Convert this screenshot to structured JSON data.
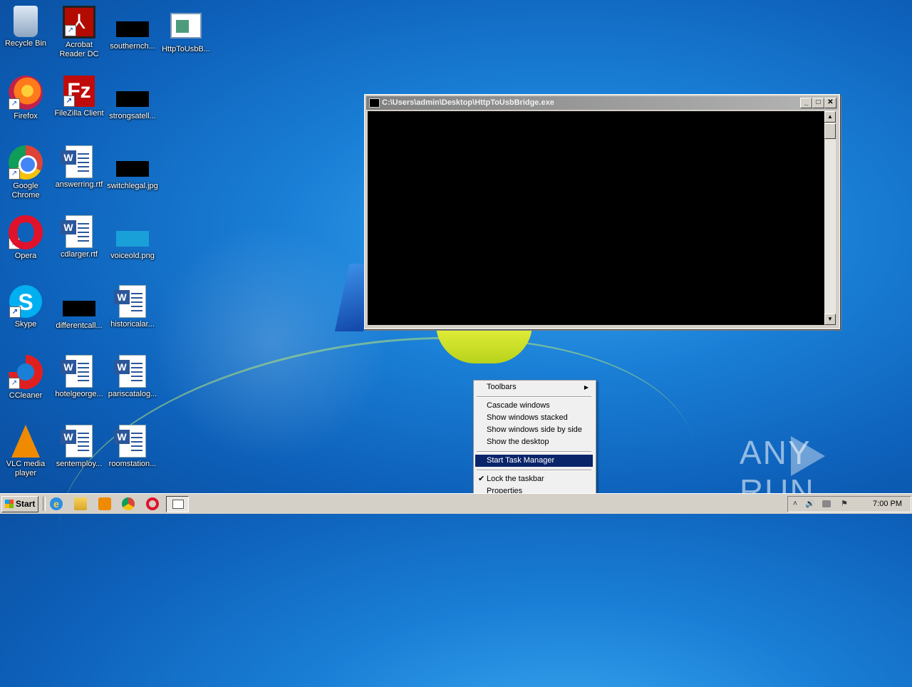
{
  "desktop_icons": [
    {
      "label": "Recycle Bin",
      "icon": "recycle-bin-icon"
    },
    {
      "label": "Acrobat Reader DC",
      "icon": "acrobat-icon"
    },
    {
      "label": "southernch...",
      "icon": "black-image-icon"
    },
    {
      "label": "HttpToUsbB...",
      "icon": "application-window-icon"
    },
    {
      "label": "Firefox",
      "icon": "firefox-icon"
    },
    {
      "label": "FileZilla Client",
      "icon": "filezilla-icon"
    },
    {
      "label": "strongsatell...",
      "icon": "black-image-icon"
    },
    {
      "label": "Google Chrome",
      "icon": "chrome-icon"
    },
    {
      "label": "answerring.rtf",
      "icon": "word-document-icon"
    },
    {
      "label": "switchlegal.jpg",
      "icon": "black-image-icon"
    },
    {
      "label": "Opera",
      "icon": "opera-icon"
    },
    {
      "label": "cdlarger.rtf",
      "icon": "word-document-icon"
    },
    {
      "label": "voiceold.png",
      "icon": "cyan-image-icon"
    },
    {
      "label": "Skype",
      "icon": "skype-icon"
    },
    {
      "label": "differentcall...",
      "icon": "black-image-icon"
    },
    {
      "label": "historicalar...",
      "icon": "word-document-icon"
    },
    {
      "label": "CCleaner",
      "icon": "ccleaner-icon"
    },
    {
      "label": "hotelgeorge...",
      "icon": "word-document-icon"
    },
    {
      "label": "pariscatalog...",
      "icon": "word-document-icon"
    },
    {
      "label": "VLC media player",
      "icon": "vlc-icon"
    },
    {
      "label": "sentemploy...",
      "icon": "word-document-icon"
    },
    {
      "label": "roomstation...",
      "icon": "word-document-icon"
    }
  ],
  "console_window": {
    "title": "C:\\Users\\admin\\Desktop\\HttpToUsbBridge.exe",
    "minimize": "_",
    "maximize": "□",
    "close": "✕"
  },
  "context_menu": {
    "toolbars": "Toolbars",
    "cascade": "Cascade windows",
    "stacked": "Show windows stacked",
    "side_by_side": "Show windows side by side",
    "show_desktop": "Show the desktop",
    "task_manager": "Start Task Manager",
    "lock_taskbar": "Lock the taskbar",
    "properties": "Properties",
    "submenu_arrow": "▶",
    "check": "✔"
  },
  "taskbar": {
    "start_label": "Start",
    "ie_glyph": "e",
    "clock": "7:00 PM",
    "tray": {
      "expand": "˄",
      "volume": "🔊",
      "flag": "⚑"
    }
  },
  "watermark": {
    "left": "ANY",
    "right": "RUN"
  }
}
